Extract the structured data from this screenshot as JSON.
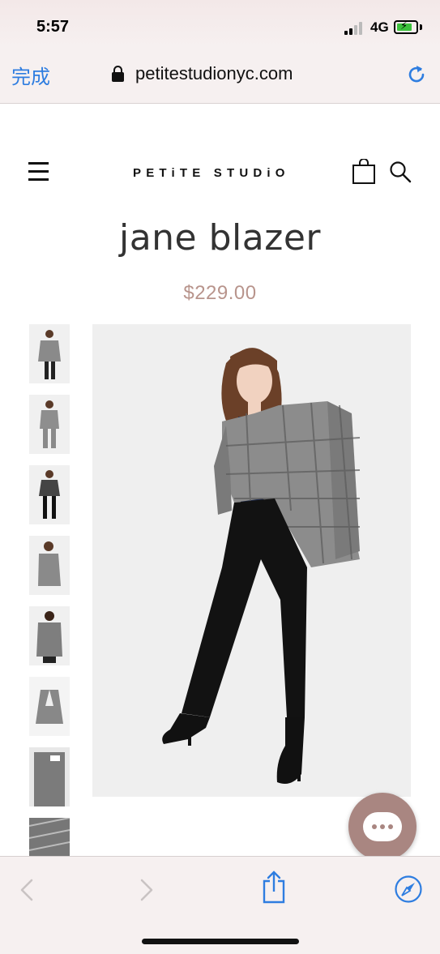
{
  "status_bar": {
    "time": "5:57",
    "network": "4G",
    "battery_color": "#3cc13c"
  },
  "browser": {
    "done_label": "完成",
    "url": "petitestudionyc.com",
    "lock_icon": "lock-icon",
    "reload_icon": "reload-icon",
    "accent_color": "#2e7de0"
  },
  "site_header": {
    "logo": "PETiTE STUDiO",
    "menu_icon": "hamburger-menu-icon",
    "bag_icon": "shopping-bag-icon",
    "search_icon": "search-icon"
  },
  "product": {
    "title": "jane blazer",
    "price": "$229.00",
    "price_color": "#b8948c",
    "thumbnail_count": 8
  },
  "chat": {
    "icon": "chat-bubble-icon",
    "color": "#a98681"
  },
  "toolbar": {
    "back_icon": "chevron-left-icon",
    "forward_icon": "chevron-right-icon",
    "share_icon": "share-icon",
    "safari_icon": "compass-icon"
  }
}
